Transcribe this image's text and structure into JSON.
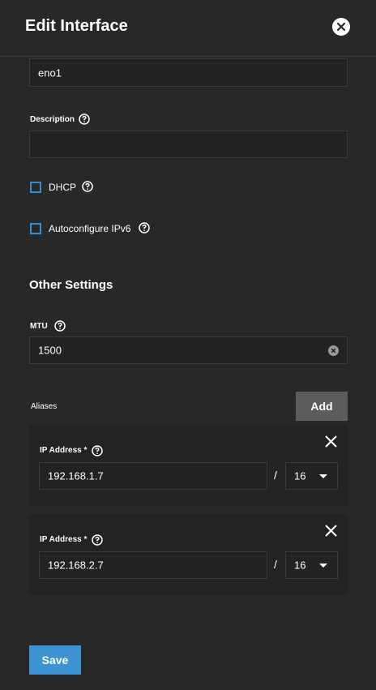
{
  "header": {
    "title": "Edit Interface"
  },
  "form": {
    "name_value": "eno1",
    "description_label": "Description",
    "description_value": "",
    "dhcp_label": "DHCP",
    "ipv6_label": "Autoconfigure IPv6",
    "other_settings_title": "Other Settings",
    "mtu_label": "MTU",
    "mtu_value": "1500",
    "aliases_label": "Aliases",
    "add_label": "Add",
    "save_label": "Save"
  },
  "aliases": [
    {
      "label": "IP Address",
      "required": "*",
      "ip": "192.168.1.7",
      "separator": "/",
      "netmask": "16"
    },
    {
      "label": "IP Address",
      "required": "*",
      "ip": "192.168.2.7",
      "separator": "/",
      "netmask": "16"
    }
  ],
  "colors": {
    "background": "#282828",
    "accent": "#3d92d1",
    "field": "#222222"
  }
}
